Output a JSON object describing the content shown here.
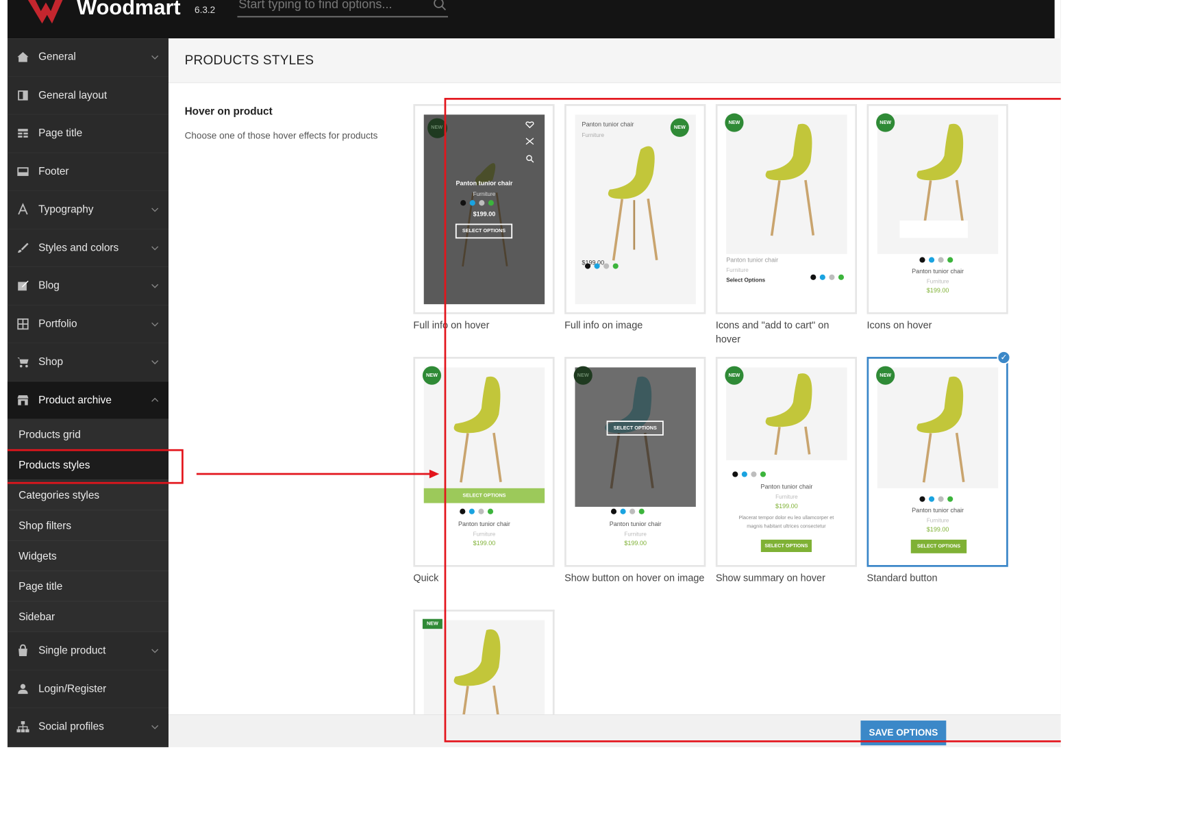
{
  "app": {
    "brand": "Woodmart",
    "version": "6.3.2",
    "search_placeholder": "Start typing to find options..."
  },
  "sidebar": {
    "items": [
      {
        "label": "General",
        "icon": "home-icon",
        "chevron": true
      },
      {
        "label": "General layout",
        "icon": "layout-icon",
        "chevron": false
      },
      {
        "label": "Page title",
        "icon": "page-title-icon",
        "chevron": false
      },
      {
        "label": "Footer",
        "icon": "footer-icon",
        "chevron": false
      },
      {
        "label": "Typography",
        "icon": "typography-icon",
        "chevron": true
      },
      {
        "label": "Styles and colors",
        "icon": "brush-icon",
        "chevron": true
      },
      {
        "label": "Blog",
        "icon": "edit-icon",
        "chevron": true
      },
      {
        "label": "Portfolio",
        "icon": "grid-icon",
        "chevron": true
      },
      {
        "label": "Shop",
        "icon": "cart-icon",
        "chevron": true
      },
      {
        "label": "Product archive",
        "icon": "store-icon",
        "chevron": true,
        "expanded": true
      }
    ],
    "sub_items": [
      "Products grid",
      "Products styles",
      "Categories styles",
      "Shop filters",
      "Widgets",
      "Page title",
      "Sidebar"
    ],
    "items_after": [
      {
        "label": "Single product",
        "icon": "bag-icon"
      },
      {
        "label": "Login/Register",
        "icon": "user-icon"
      },
      {
        "label": "Social profiles",
        "icon": "network-icon"
      }
    ]
  },
  "page": {
    "title": "PRODUCTS STYLES",
    "option_title": "Hover on product",
    "option_desc": "Choose one of those hover effects for products",
    "save_label": "SAVE OPTIONS"
  },
  "product": {
    "name": "Panton tunior chair",
    "category": "Furniture",
    "price": "$199.00",
    "badge": "NEW",
    "select": "SELECT OPTIONS",
    "select_link": "Select Options",
    "summary": "Placerat tempor dolor eu leo ullamcorper et magnis habitant ultrices consectetur"
  },
  "styles": [
    {
      "caption": "Full info on hover"
    },
    {
      "caption": "Full info on image"
    },
    {
      "caption": "Icons and \"add to cart\" on hover"
    },
    {
      "caption": "Icons on hover"
    },
    {
      "caption": "Quick"
    },
    {
      "caption": "Show button on hover on image"
    },
    {
      "caption": "Show summary on hover"
    },
    {
      "caption": "Standard button",
      "selected": true
    },
    {
      "caption": ""
    }
  ],
  "colors": {
    "accent": "#3b88c8",
    "green": "#7fb135",
    "highlight": "#e3151c",
    "swatches": [
      "#111111",
      "#1aa3e0",
      "#bdbdbd",
      "#3cb43c"
    ]
  }
}
